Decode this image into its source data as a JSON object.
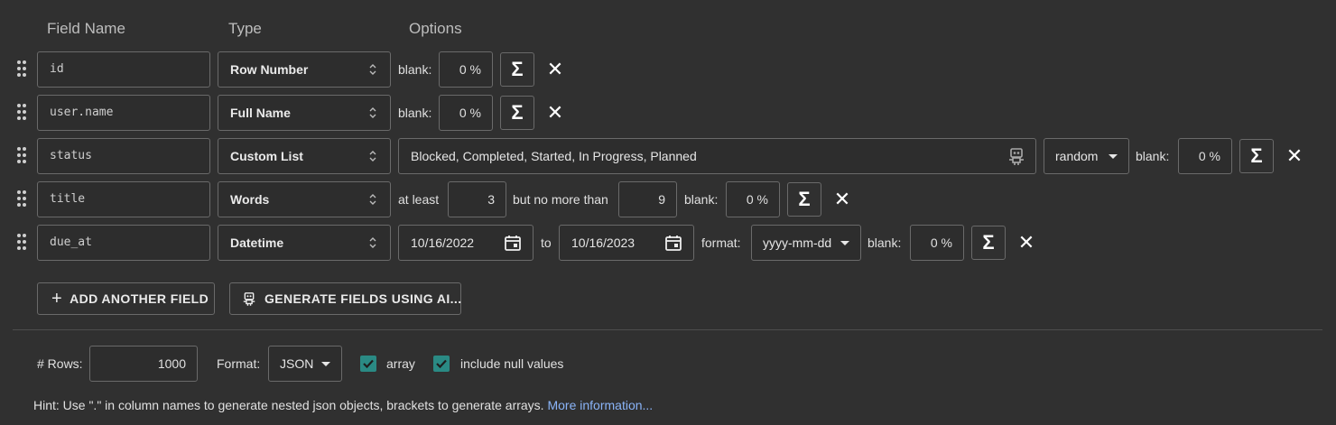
{
  "headers": {
    "field_name": "Field Name",
    "type": "Type",
    "options": "Options"
  },
  "labels": {
    "blank": "blank:",
    "at_least": "at least",
    "no_more_than": "but no more than",
    "to": "to",
    "format": "format:"
  },
  "fields": [
    {
      "name": "id",
      "type": "Row Number",
      "blank": "0 %"
    },
    {
      "name": "user.name",
      "type": "Full Name",
      "blank": "0 %"
    },
    {
      "name": "status",
      "type": "Custom List",
      "list_values": "Blocked, Completed, Started, In Progress, Planned",
      "distribution": "random",
      "blank": "0 %"
    },
    {
      "name": "title",
      "type": "Words",
      "min": "3",
      "max": "9",
      "blank": "0 %"
    },
    {
      "name": "due_at",
      "type": "Datetime",
      "from": "10/16/2022",
      "to": "10/16/2023",
      "format": "yyyy-mm-dd",
      "blank": "0 %"
    }
  ],
  "actions": {
    "add_field": "ADD ANOTHER FIELD",
    "generate_ai": "GENERATE FIELDS USING AI..."
  },
  "footer": {
    "rows_label": "# Rows:",
    "rows_value": "1000",
    "format_label": "Format:",
    "format_value": "JSON",
    "array_label": "array",
    "array_checked": true,
    "null_label": "include null values",
    "null_checked": true,
    "hint": "Hint: Use \".\" in column names to generate nested json objects, brackets to generate arrays.",
    "more_info": "More information..."
  },
  "icons": {
    "formula": "sigma-icon",
    "remove": "close-icon",
    "drag": "drag-handle-icon",
    "ai": "robot-icon",
    "calendar": "calendar-icon"
  },
  "colors": {
    "checkbox": "#2a8a84",
    "link": "#8ab4f8",
    "background": "#303030"
  }
}
